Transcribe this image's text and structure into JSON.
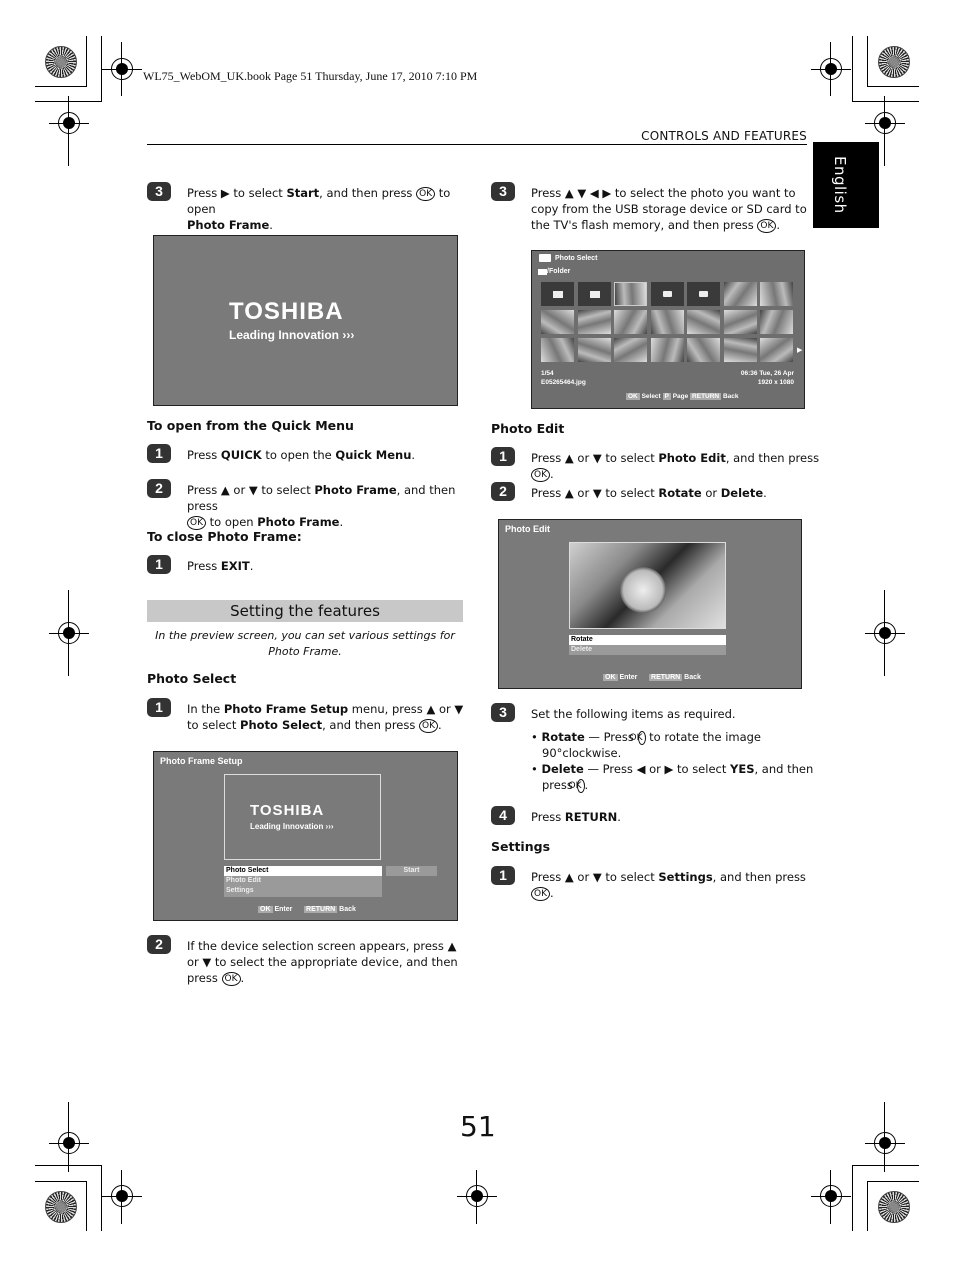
{
  "print_header": "WL75_WebOM_UK.book  Page 51  Thursday, June 17, 2010  7:10 PM",
  "section_title": "CONTROLS AND FEATURES",
  "language_tab": "English",
  "page_number": "51",
  "left": {
    "step3": {
      "num": "3",
      "pre": "Press ▶ to select ",
      "b1": "Start",
      "mid": ", and then press ",
      "ok": "OK",
      "post": " to open ",
      "b2": "Photo Frame",
      "end": "."
    },
    "splash": {
      "brand": "TOSHIBA",
      "tagline": "Leading Innovation ›››"
    },
    "quick_menu": {
      "heading": "To open from the Quick Menu",
      "step1": {
        "num": "1",
        "pre": "Press ",
        "b1": "QUICK",
        "mid": " to open the ",
        "b2": "Quick Menu",
        "end": "."
      },
      "step2": {
        "num": "2",
        "pre": "Press ▲ or ▼ to select ",
        "b1": "Photo Frame",
        "mid": ", and then press",
        "ok": "OK",
        "post": " to open ",
        "b2": "Photo Frame",
        "end": "."
      }
    },
    "close": {
      "heading": "To close Photo Frame:",
      "step1": {
        "num": "1",
        "pre": "Press ",
        "b1": "EXIT",
        "end": "."
      }
    },
    "banner": "Setting the features",
    "intro": "In the preview screen, you can set various settings for Photo Frame.",
    "photo_select": {
      "heading": "Photo Select",
      "step1": {
        "num": "1",
        "pre": "In the ",
        "b1": "Photo Frame Setup",
        "mid": " menu, press ▲ or ▼ to select ",
        "b2": "Photo Select",
        "post": ", and then press ",
        "ok": "OK",
        "end": "."
      },
      "step2": {
        "num": "2",
        "text": "If the device selection screen appears, press ▲ or ▼ to select the appropriate device, and then press ",
        "ok": "OK",
        "end": "."
      }
    },
    "setup_screen": {
      "title": "Photo Frame Setup",
      "brand": "TOSHIBA",
      "tagline": "Leading Innovation ›››",
      "menu": [
        "Photo Select",
        "Photo Edit",
        "Settings"
      ],
      "selected_index": 0,
      "start_label": "Start",
      "footer": [
        {
          "key": "OK",
          "label": "Enter"
        },
        {
          "key": "RETURN",
          "label": "Back"
        }
      ]
    }
  },
  "right": {
    "step3": {
      "num": "3",
      "text": "Press ▲ ▼ ◀ ▶ to select the photo you want to copy from the USB storage device or SD card to the TV's flash memory, and then press ",
      "ok": "OK",
      "end": "."
    },
    "select_screen": {
      "title": "Photo Select",
      "folder": "/Folder",
      "index": "1/54",
      "filename": "E05265464.jpg",
      "datetime": "06:36 Tue, 26 Apr",
      "resolution": "1920 x 1080",
      "footer": [
        {
          "key": "OK",
          "label": "Select"
        },
        {
          "key": "P",
          "label": "Page"
        },
        {
          "key": "RETURN",
          "label": "Back"
        }
      ]
    },
    "photo_edit": {
      "heading": "Photo Edit",
      "step1": {
        "num": "1",
        "pre": "Press ▲ or ▼ to select ",
        "b1": "Photo Edit",
        "mid": ", and then press ",
        "ok": "OK",
        "end": "."
      },
      "step2": {
        "num": "2",
        "pre": "Press ▲ or ▼ to select ",
        "b1": "Rotate",
        "mid": " or ",
        "b2": "Delete",
        "end": "."
      },
      "step3": {
        "num": "3",
        "text": "Set the following items as required."
      },
      "bullet1": {
        "b": "Rotate",
        "pre": " — Press ",
        "ok": "OK",
        "post": " to rotate the image 90°clockwise."
      },
      "bullet2": {
        "b": "Delete",
        "pre": " — Press ◀ or ▶ to select ",
        "b2": "YES",
        "post": ", and then press ",
        "ok": "OK",
        "end": "."
      },
      "step4": {
        "num": "4",
        "pre": "Press ",
        "b1": "RETURN",
        "end": "."
      }
    },
    "edit_screen": {
      "title": "Photo Edit",
      "menu": [
        "Rotate",
        "Delete"
      ],
      "selected_index": 0,
      "footer": [
        {
          "key": "OK",
          "label": "Enter"
        },
        {
          "key": "RETURN",
          "label": "Back"
        }
      ]
    },
    "settings": {
      "heading": "Settings",
      "step1": {
        "num": "1",
        "pre": "Press ▲ or ▼ to select ",
        "b1": "Settings",
        "mid": ", and then press ",
        "ok": "OK",
        "end": "."
      }
    }
  }
}
